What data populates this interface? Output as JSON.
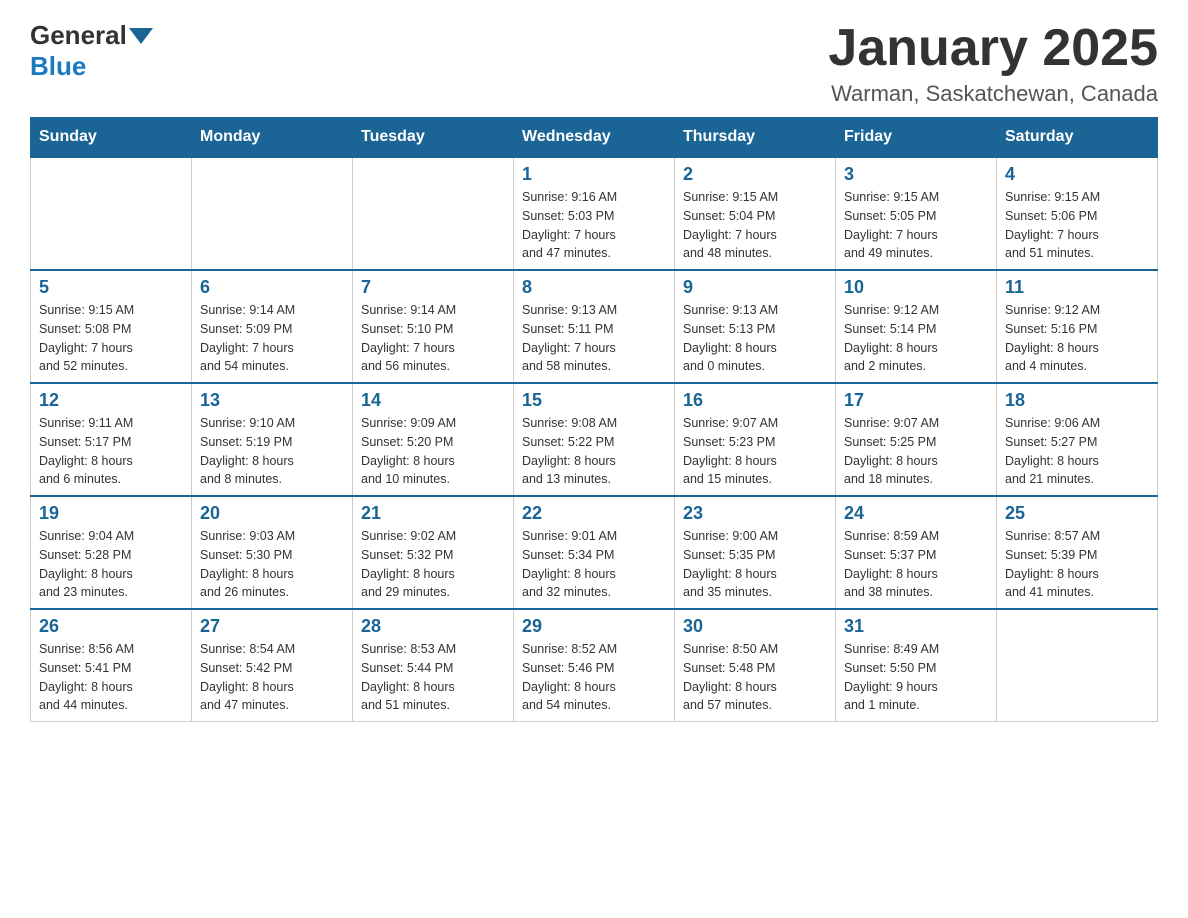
{
  "header": {
    "logo_general": "General",
    "logo_blue": "Blue",
    "month_title": "January 2025",
    "location": "Warman, Saskatchewan, Canada"
  },
  "days_of_week": [
    "Sunday",
    "Monday",
    "Tuesday",
    "Wednesday",
    "Thursday",
    "Friday",
    "Saturday"
  ],
  "weeks": [
    [
      {
        "day": "",
        "info": ""
      },
      {
        "day": "",
        "info": ""
      },
      {
        "day": "",
        "info": ""
      },
      {
        "day": "1",
        "info": "Sunrise: 9:16 AM\nSunset: 5:03 PM\nDaylight: 7 hours\nand 47 minutes."
      },
      {
        "day": "2",
        "info": "Sunrise: 9:15 AM\nSunset: 5:04 PM\nDaylight: 7 hours\nand 48 minutes."
      },
      {
        "day": "3",
        "info": "Sunrise: 9:15 AM\nSunset: 5:05 PM\nDaylight: 7 hours\nand 49 minutes."
      },
      {
        "day": "4",
        "info": "Sunrise: 9:15 AM\nSunset: 5:06 PM\nDaylight: 7 hours\nand 51 minutes."
      }
    ],
    [
      {
        "day": "5",
        "info": "Sunrise: 9:15 AM\nSunset: 5:08 PM\nDaylight: 7 hours\nand 52 minutes."
      },
      {
        "day": "6",
        "info": "Sunrise: 9:14 AM\nSunset: 5:09 PM\nDaylight: 7 hours\nand 54 minutes."
      },
      {
        "day": "7",
        "info": "Sunrise: 9:14 AM\nSunset: 5:10 PM\nDaylight: 7 hours\nand 56 minutes."
      },
      {
        "day": "8",
        "info": "Sunrise: 9:13 AM\nSunset: 5:11 PM\nDaylight: 7 hours\nand 58 minutes."
      },
      {
        "day": "9",
        "info": "Sunrise: 9:13 AM\nSunset: 5:13 PM\nDaylight: 8 hours\nand 0 minutes."
      },
      {
        "day": "10",
        "info": "Sunrise: 9:12 AM\nSunset: 5:14 PM\nDaylight: 8 hours\nand 2 minutes."
      },
      {
        "day": "11",
        "info": "Sunrise: 9:12 AM\nSunset: 5:16 PM\nDaylight: 8 hours\nand 4 minutes."
      }
    ],
    [
      {
        "day": "12",
        "info": "Sunrise: 9:11 AM\nSunset: 5:17 PM\nDaylight: 8 hours\nand 6 minutes."
      },
      {
        "day": "13",
        "info": "Sunrise: 9:10 AM\nSunset: 5:19 PM\nDaylight: 8 hours\nand 8 minutes."
      },
      {
        "day": "14",
        "info": "Sunrise: 9:09 AM\nSunset: 5:20 PM\nDaylight: 8 hours\nand 10 minutes."
      },
      {
        "day": "15",
        "info": "Sunrise: 9:08 AM\nSunset: 5:22 PM\nDaylight: 8 hours\nand 13 minutes."
      },
      {
        "day": "16",
        "info": "Sunrise: 9:07 AM\nSunset: 5:23 PM\nDaylight: 8 hours\nand 15 minutes."
      },
      {
        "day": "17",
        "info": "Sunrise: 9:07 AM\nSunset: 5:25 PM\nDaylight: 8 hours\nand 18 minutes."
      },
      {
        "day": "18",
        "info": "Sunrise: 9:06 AM\nSunset: 5:27 PM\nDaylight: 8 hours\nand 21 minutes."
      }
    ],
    [
      {
        "day": "19",
        "info": "Sunrise: 9:04 AM\nSunset: 5:28 PM\nDaylight: 8 hours\nand 23 minutes."
      },
      {
        "day": "20",
        "info": "Sunrise: 9:03 AM\nSunset: 5:30 PM\nDaylight: 8 hours\nand 26 minutes."
      },
      {
        "day": "21",
        "info": "Sunrise: 9:02 AM\nSunset: 5:32 PM\nDaylight: 8 hours\nand 29 minutes."
      },
      {
        "day": "22",
        "info": "Sunrise: 9:01 AM\nSunset: 5:34 PM\nDaylight: 8 hours\nand 32 minutes."
      },
      {
        "day": "23",
        "info": "Sunrise: 9:00 AM\nSunset: 5:35 PM\nDaylight: 8 hours\nand 35 minutes."
      },
      {
        "day": "24",
        "info": "Sunrise: 8:59 AM\nSunset: 5:37 PM\nDaylight: 8 hours\nand 38 minutes."
      },
      {
        "day": "25",
        "info": "Sunrise: 8:57 AM\nSunset: 5:39 PM\nDaylight: 8 hours\nand 41 minutes."
      }
    ],
    [
      {
        "day": "26",
        "info": "Sunrise: 8:56 AM\nSunset: 5:41 PM\nDaylight: 8 hours\nand 44 minutes."
      },
      {
        "day": "27",
        "info": "Sunrise: 8:54 AM\nSunset: 5:42 PM\nDaylight: 8 hours\nand 47 minutes."
      },
      {
        "day": "28",
        "info": "Sunrise: 8:53 AM\nSunset: 5:44 PM\nDaylight: 8 hours\nand 51 minutes."
      },
      {
        "day": "29",
        "info": "Sunrise: 8:52 AM\nSunset: 5:46 PM\nDaylight: 8 hours\nand 54 minutes."
      },
      {
        "day": "30",
        "info": "Sunrise: 8:50 AM\nSunset: 5:48 PM\nDaylight: 8 hours\nand 57 minutes."
      },
      {
        "day": "31",
        "info": "Sunrise: 8:49 AM\nSunset: 5:50 PM\nDaylight: 9 hours\nand 1 minute."
      },
      {
        "day": "",
        "info": ""
      }
    ]
  ]
}
